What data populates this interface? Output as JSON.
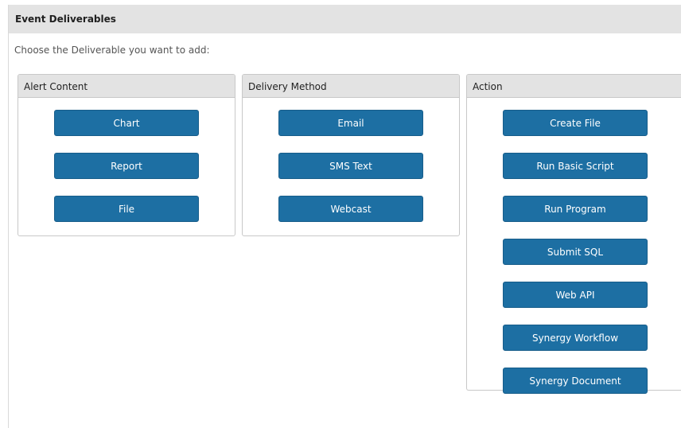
{
  "header": {
    "title": "Event Deliverables"
  },
  "instruction": "Choose the Deliverable you want to add:",
  "panels": {
    "alert_content": {
      "title": "Alert Content",
      "buttons": [
        "Chart",
        "Report",
        "File"
      ]
    },
    "delivery_method": {
      "title": "Delivery Method",
      "buttons": [
        "Email",
        "SMS Text",
        "Webcast"
      ]
    },
    "action": {
      "title": "Action",
      "buttons": [
        "Create File",
        "Run Basic Script",
        "Run Program",
        "Submit SQL",
        "Web API",
        "Synergy Workflow",
        "Synergy Document"
      ]
    }
  },
  "colors": {
    "button_bg": "#1d6fa3",
    "header_bg": "#e3e3e3"
  }
}
